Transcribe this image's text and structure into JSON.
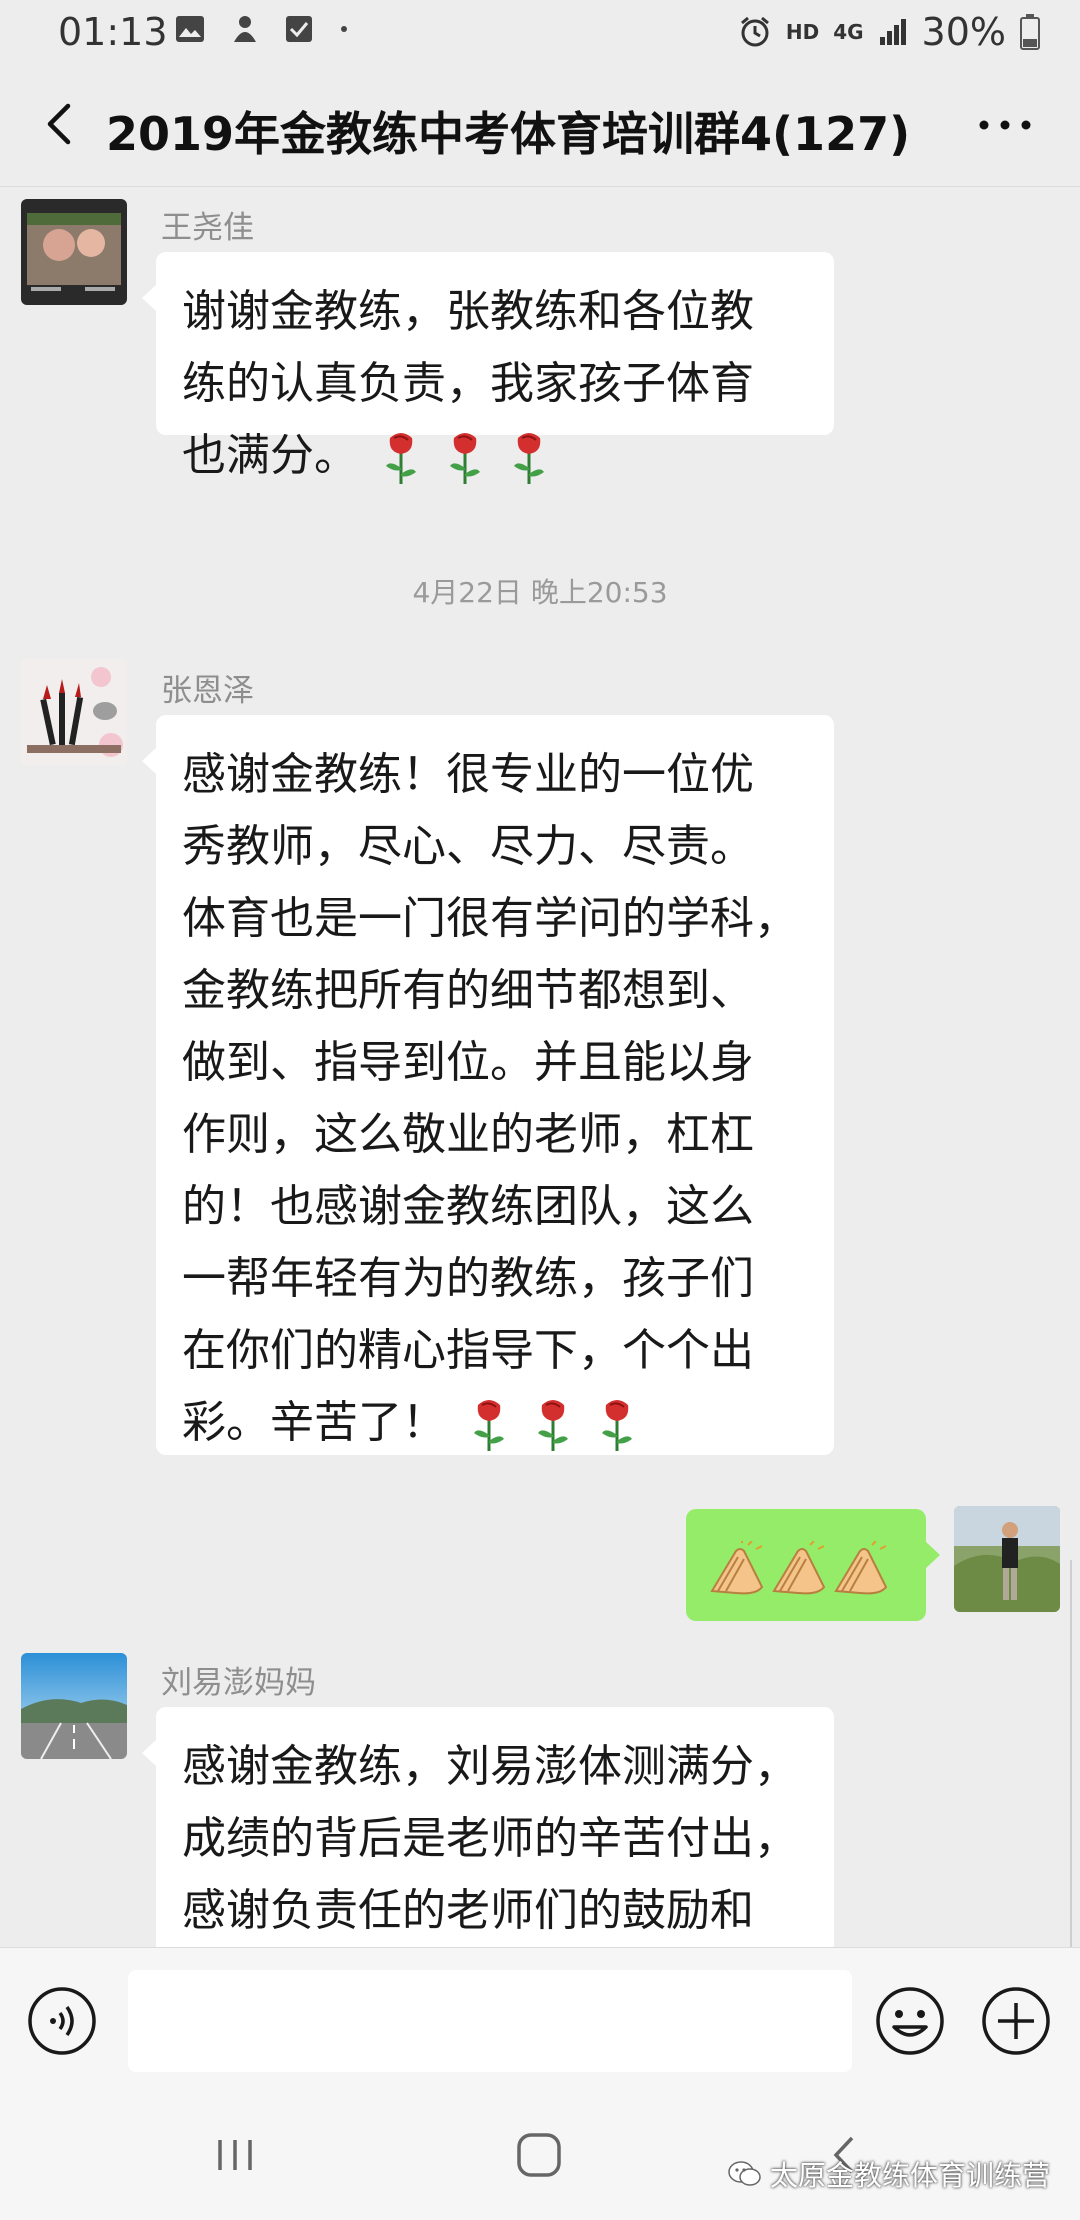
{
  "status_bar": {
    "time": "01:13",
    "network_hd": "HD",
    "network_type": "4G",
    "battery": "30%"
  },
  "header": {
    "title": "2019年金教练中考体育培训群4(127)"
  },
  "messages": [
    {
      "sender": "王尧佳",
      "text": "谢谢金教练，张教练和各位教\n练的认真负责，我家孩子体育\n也满分。"
    },
    {
      "timestamp": "4月22日 晚上20:53"
    },
    {
      "sender": "张恩泽",
      "text": "感谢金教练！很专业的一位优\n秀教师，尽心、尽力、尽责。\n体育也是一门很有学问的学科，\n金教练把所有的细节都想到、\n做到、指导到位。并且能以身\n作则，这么敬业的老师，杠杠\n的！也感谢金教练团队，这么\n一帮年轻有为的教练，孩子们\n在你们的精心指导下，个个出\n彩。辛苦了！"
    },
    {
      "sender": "刘易澎妈妈",
      "text": "感谢金教练，刘易澎体测满分，\n成绩的背后是老师的辛苦付出，\n感谢负责任的老师们的鼓励和"
    }
  ],
  "watermark": "太原金教练体育训练营",
  "colors": {
    "background": "#ededed",
    "bubble_incoming": "#ffffff",
    "bubble_outgoing": "#95ec69"
  }
}
